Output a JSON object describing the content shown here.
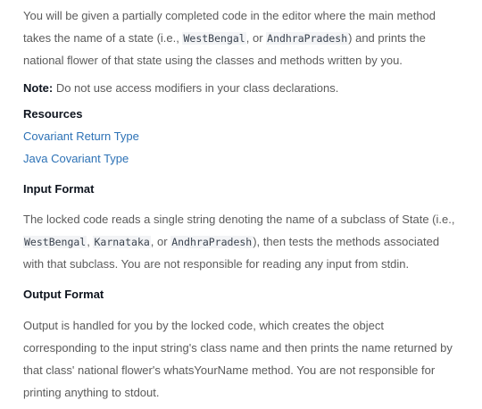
{
  "intro": {
    "l1": "You will be given a partially completed code in the editor where the main method",
    "l2a": "takes the name of a state (i.e., ",
    "l2code1": "WestBengal",
    "l2b": ", or ",
    "l2code2": "AndhraPradesh",
    "l2c": ") and prints the",
    "l3": "national flower of that state using the classes and methods written by you."
  },
  "note": {
    "label": "Note:",
    "text": " Do not use access modifiers in your class declarations."
  },
  "resources": {
    "heading": "Resources",
    "links": [
      "Covariant Return Type",
      "Java Covariant Type"
    ]
  },
  "input_format": {
    "heading": "Input Format",
    "l1": "The locked code reads a single string denoting the name of a subclass of State (i.e.,",
    "code1": "WestBengal",
    "sep1": ", ",
    "code2": "Karnataka",
    "sep2": ", or ",
    "code3": "AndhraPradesh",
    "l2rest": "), then tests the methods associated",
    "l3": "with that subclass. You are not responsible for reading any input from stdin."
  },
  "output_format": {
    "heading": "Output Format",
    "l1": "Output is handled for you by the locked code, which creates the object",
    "l2": "corresponding to the input string's class name and then prints the name returned by",
    "l3": "that class' national flower's whatsYourName method. You are not responsible for",
    "l4": "printing anything to stdout."
  }
}
